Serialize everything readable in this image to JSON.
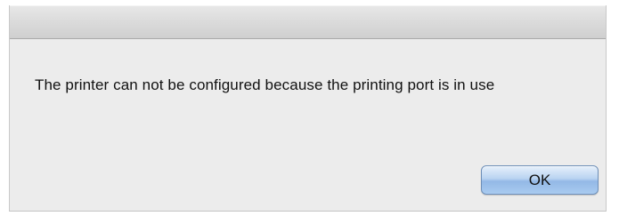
{
  "dialog": {
    "message": "The printer can not be configured because the printing port is in use",
    "ok_label": "OK"
  },
  "colors": {
    "background": "#ececec",
    "titlebar": "#d6d6d6",
    "button_accent": "#a9cbf0"
  }
}
